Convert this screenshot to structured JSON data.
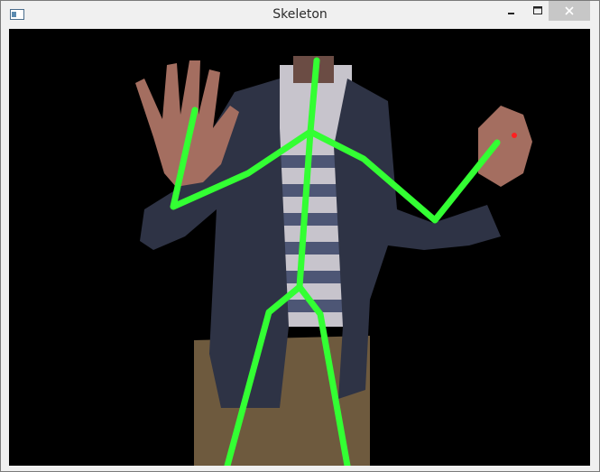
{
  "window": {
    "title": "Skeleton",
    "icons": {
      "app": "window-app-icon",
      "minimize": "minimize-icon",
      "maximize": "maximize-icon",
      "close": "close-icon"
    }
  },
  "colors": {
    "background": "#000000",
    "skeleton": "#33ff33",
    "jacket": "#2e3345",
    "skin": "#a46e60",
    "pants": "#6e5a3e",
    "shirt_light": "#c7c4cc",
    "shirt_dark": "#4d5675",
    "marker": "#ff2020"
  }
}
